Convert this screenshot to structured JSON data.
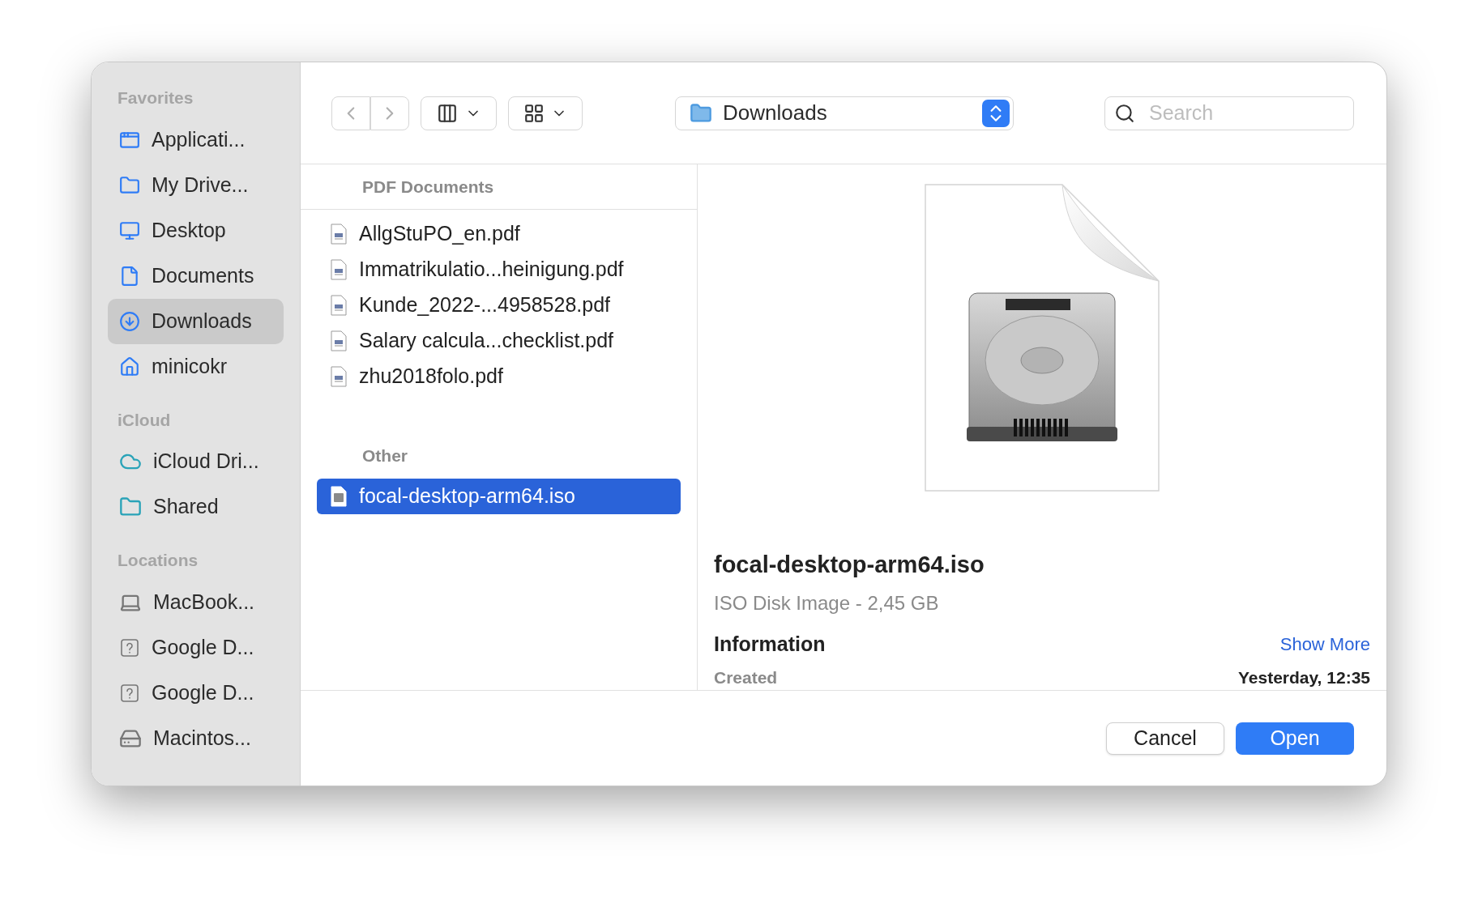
{
  "sidebar": {
    "sections": [
      {
        "title": "Favorites",
        "items": [
          {
            "label": "Applicati...",
            "kind": "applications",
            "selected": false
          },
          {
            "label": "My Drive...",
            "kind": "folder",
            "selected": false
          },
          {
            "label": "Desktop",
            "kind": "desktop",
            "selected": false
          },
          {
            "label": "Documents",
            "kind": "document",
            "selected": false
          },
          {
            "label": "Downloads",
            "kind": "downloads",
            "selected": true
          },
          {
            "label": "minicokr",
            "kind": "home",
            "selected": false
          }
        ]
      },
      {
        "title": "iCloud",
        "items": [
          {
            "label": "iCloud Dri...",
            "kind": "cloud",
            "selected": false
          },
          {
            "label": "Shared",
            "kind": "shared",
            "selected": false
          }
        ]
      },
      {
        "title": "Locations",
        "items": [
          {
            "label": "MacBook...",
            "kind": "laptop",
            "selected": false
          },
          {
            "label": "Google D...",
            "kind": "unknown",
            "selected": false
          },
          {
            "label": "Google D...",
            "kind": "unknown",
            "selected": false
          },
          {
            "label": "Macintos...",
            "kind": "disk",
            "selected": false
          }
        ]
      }
    ]
  },
  "toolbar": {
    "location": "Downloads",
    "search": {
      "placeholder": "Search"
    }
  },
  "file_list": {
    "groups": [
      {
        "title": "PDF Documents",
        "files": [
          {
            "name": "AllgStuPO_en.pdf",
            "kind": "pdf",
            "selected": false
          },
          {
            "name": "Immatrikulatio...heinigung.pdf",
            "kind": "pdf",
            "selected": false
          },
          {
            "name": "Kunde_2022-...4958528.pdf",
            "kind": "pdf",
            "selected": false
          },
          {
            "name": "Salary calcula...checklist.pdf",
            "kind": "pdf",
            "selected": false
          },
          {
            "name": "zhu2018folo.pdf",
            "kind": "pdf",
            "selected": false
          }
        ]
      },
      {
        "title": "Other",
        "files": [
          {
            "name": "focal-desktop-arm64.iso",
            "kind": "iso",
            "selected": true
          }
        ]
      }
    ]
  },
  "preview": {
    "title": "focal-desktop-arm64.iso",
    "subtitle": "ISO Disk Image - 2,45 GB",
    "section": "Information",
    "show_more": "Show More",
    "rows": [
      {
        "label": "Created",
        "value": "Yesterday, 12:35"
      }
    ]
  },
  "buttons": [
    {
      "label": "Cancel",
      "kind": "secondary"
    },
    {
      "label": "Open",
      "kind": "primary"
    }
  ]
}
